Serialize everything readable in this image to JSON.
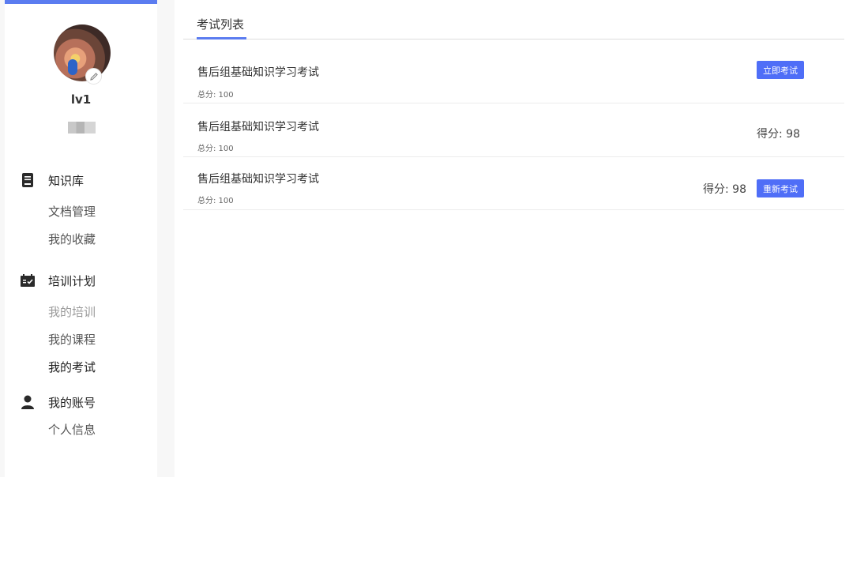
{
  "user": {
    "name": "lv1"
  },
  "sidebar": {
    "groups": [
      {
        "title": "知识库",
        "icon": "book-icon",
        "items": [
          {
            "label": "文档管理"
          },
          {
            "label": "我的收藏"
          }
        ]
      },
      {
        "title": "培训计划",
        "icon": "calendar-check-icon",
        "items": [
          {
            "label": "我的培训"
          },
          {
            "label": "我的课程"
          },
          {
            "label": "我的考试"
          }
        ]
      },
      {
        "title": "我的账号",
        "icon": "user-icon",
        "items": [
          {
            "label": "个人信息"
          }
        ]
      }
    ]
  },
  "main": {
    "tab_label": "考试列表",
    "exams": [
      {
        "title": "售后组基础知识学习考试",
        "total": "总分: 100",
        "score": "",
        "action": "立即考试"
      },
      {
        "title": "售后组基础知识学习考试",
        "total": "总分: 100",
        "score": "得分: 98",
        "action": ""
      },
      {
        "title": "售后组基础知识学习考试",
        "total": "总分: 100",
        "score": "得分: 98",
        "action": "重新考试"
      }
    ]
  },
  "colors": {
    "accent": "#4f6ef7",
    "topbar": "#5b7cf0"
  }
}
